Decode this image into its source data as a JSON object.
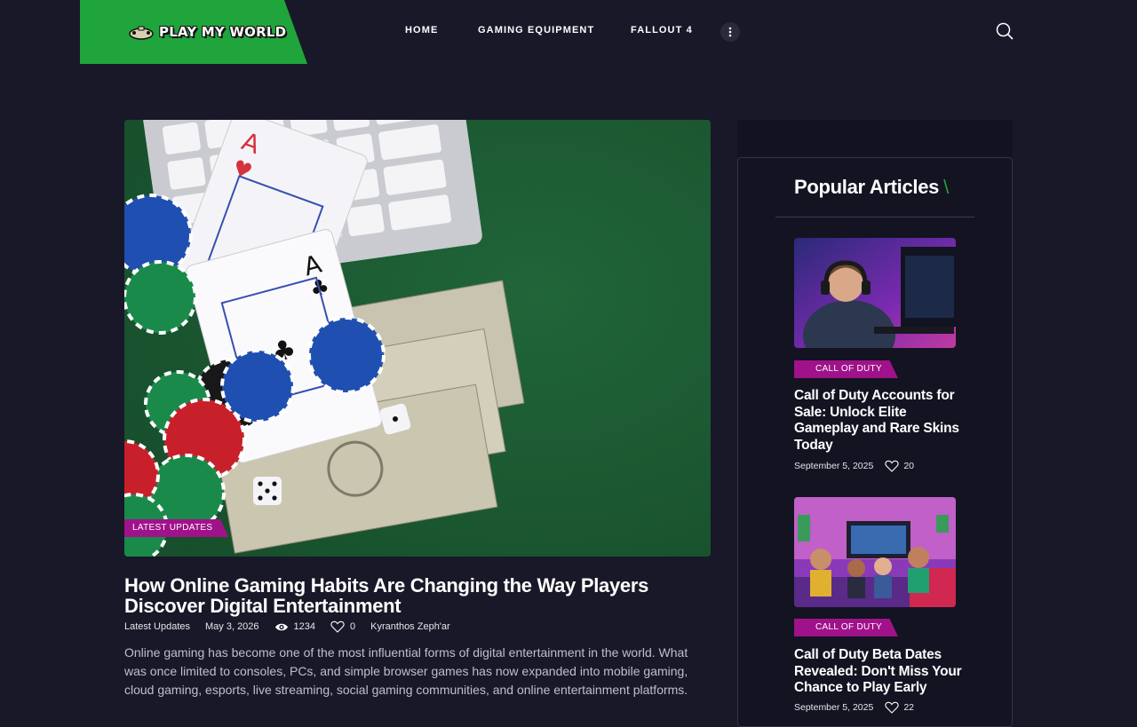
{
  "header": {
    "logo_text": "PLAY MY WORLD",
    "nav": [
      "HOME",
      "GAMING EQUIPMENT",
      "FALLOUT 4"
    ],
    "more_icon": "vertical-dots-icon",
    "search_icon": "search-icon"
  },
  "featured": {
    "category": "LATEST UPDATES",
    "title": "How Online Gaming Habits Are Changing the Way Players Discover Digital Entertainment",
    "meta": {
      "category": "Latest Updates",
      "date": "May 3, 2026",
      "views": "1234",
      "likes": "0",
      "author": "Kyranthos Zeph'ar"
    },
    "excerpt": "Online gaming has become one of the most influential forms of digital entertainment in the world. What was once limited to consoles, PCs, and simple browser games has now expanded into mobile gaming, cloud gaming, esports, live streaming, social gaming communities, and online entertainment platforms."
  },
  "sidebar": {
    "heading": "Popular Articles",
    "heading_accent": "\\",
    "articles": [
      {
        "category": "CALL OF DUTY",
        "title": "Call of Duty Accounts for Sale: Unlock Elite Gameplay and Rare Skins Today",
        "date": "September 5, 2025",
        "likes": "20"
      },
      {
        "category": "CALL OF DUTY",
        "title": "Call of Duty Beta Dates Revealed: Don't Miss Your Chance to Play Early",
        "date": "September 5, 2025",
        "likes": "22"
      }
    ]
  },
  "colors": {
    "background": "#181828",
    "brand_green": "#1fa53b",
    "badge_magenta": "#a0128a"
  }
}
